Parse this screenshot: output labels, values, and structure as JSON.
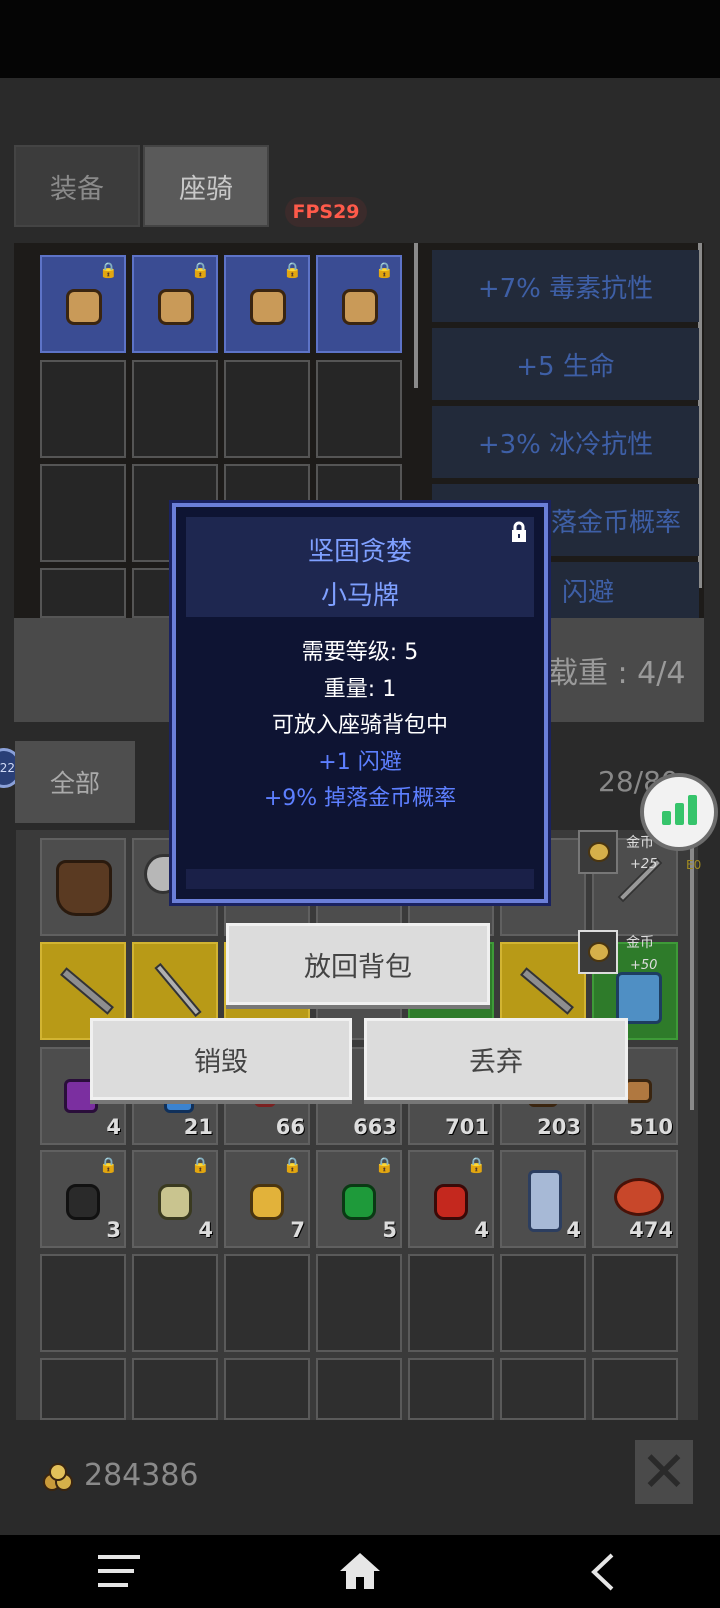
{
  "tabs": [
    {
      "label": "装备",
      "active": false
    },
    {
      "label": "座骑",
      "active": true
    }
  ],
  "fps_label": "FPS29",
  "mount_stats": [
    "+7% 毒素抗性",
    "+5 生命",
    "+3% 冰冷抗性",
    "落金币概率",
    "闪避"
  ],
  "weight_label": "载重 : 4/4",
  "filter_label": "全部",
  "side_badge": "22",
  "bag_count": "28/80",
  "gold_notifications": [
    {
      "label": "金币",
      "amount": "+25"
    },
    {
      "label": "金币",
      "amount": "+50"
    }
  ],
  "gold_hint": "E0",
  "row3_quantities": [
    "4",
    "21",
    "66",
    "663",
    "701",
    "203",
    "510"
  ],
  "row4_quantities": [
    "3",
    "4",
    "7",
    "5",
    "4",
    "4",
    "474"
  ],
  "popup": {
    "title": "坚固贪婪",
    "subtitle": "小马牌",
    "level_req": "需要等级: 5",
    "weight": "重量: 1",
    "note": "可放入座骑背包中",
    "bonus1": "+1 闪避",
    "bonus2": "+9% 掉落金币概率"
  },
  "actions": {
    "return_label": "放回背包",
    "destroy_label": "销毁",
    "discard_label": "丢弃"
  },
  "gold_total": "284386",
  "colors": {
    "accent_blue": "#6b7fd9",
    "fps_red": "#ff5a4a",
    "stats_green": "#36c46b"
  }
}
